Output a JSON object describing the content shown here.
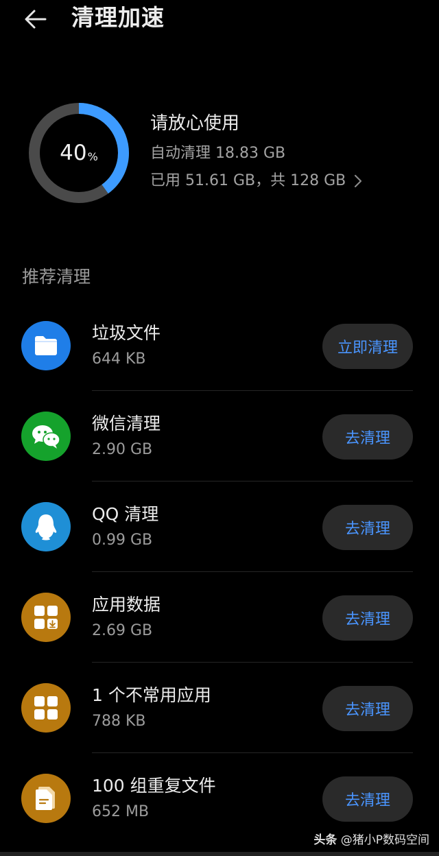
{
  "header": {
    "title": "清理加速",
    "back_icon": "back-arrow-icon"
  },
  "storage": {
    "percent": 40,
    "percent_value": "40",
    "percent_unit": "%",
    "ring_color": "#3d9bff",
    "track_color": "#4a4a4a",
    "status_title": "请放心使用",
    "auto_clean": "自动清理 18.83 GB",
    "usage": "已用 51.61 GB，共 128 GB"
  },
  "section": {
    "title": "推荐清理"
  },
  "items": [
    {
      "name": "垃圾文件",
      "size": "644 KB",
      "button": "立即清理",
      "icon": "folder-icon",
      "color": "#1f7ee8"
    },
    {
      "name": "微信清理",
      "size": "2.90 GB",
      "button": "去清理",
      "icon": "wechat-icon",
      "color": "#15a22c"
    },
    {
      "name": "QQ 清理",
      "size": "0.99 GB",
      "button": "去清理",
      "icon": "qq-penguin-icon",
      "color": "#1f8fd6"
    },
    {
      "name": "应用数据",
      "size": "2.69 GB",
      "button": "去清理",
      "icon": "app-data-icon",
      "color": "#b8790f"
    },
    {
      "name": "1 个不常用应用",
      "size": "788 KB",
      "button": "去清理",
      "icon": "apps-grid-icon",
      "color": "#b8790f"
    },
    {
      "name": "100 组重复文件",
      "size": "652 MB",
      "button": "去清理",
      "icon": "duplicate-files-icon",
      "color": "#b8790f"
    }
  ],
  "watermark": {
    "brand": "头条",
    "handle": "@猪小P数码空间"
  }
}
